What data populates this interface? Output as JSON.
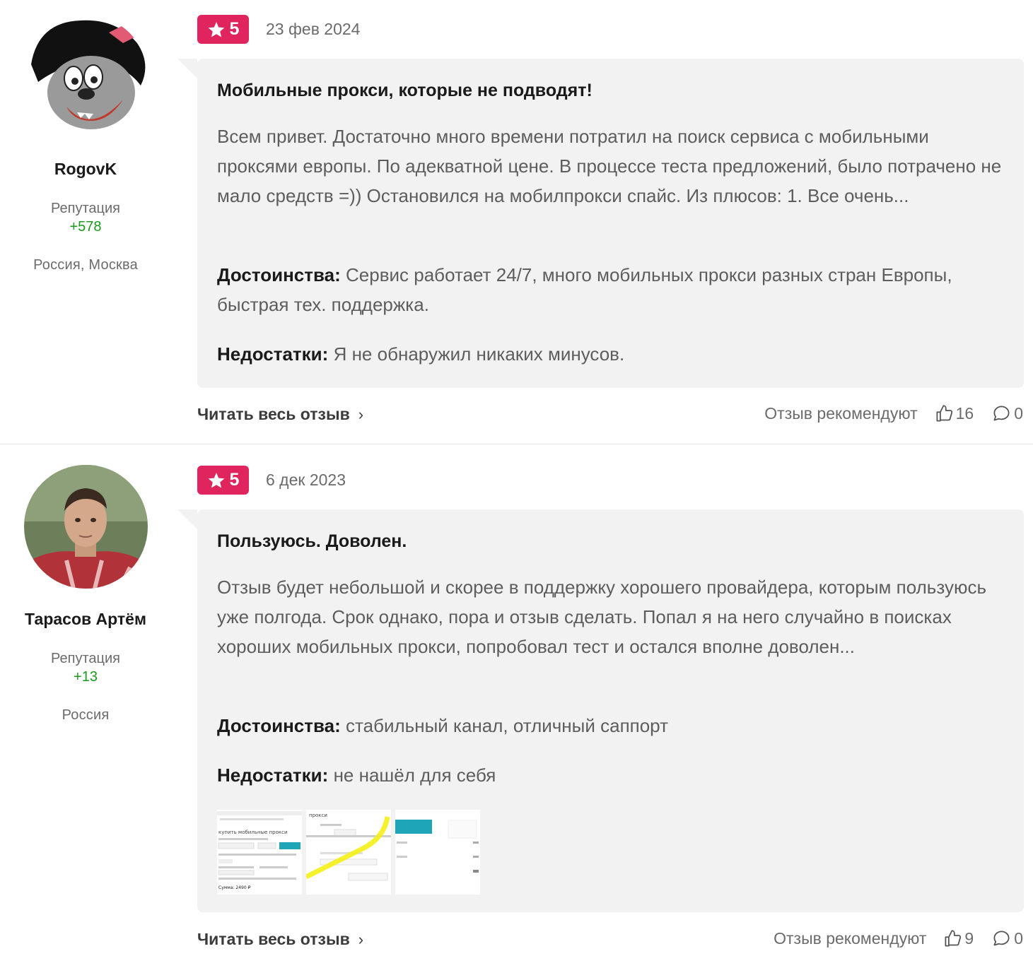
{
  "reviews": [
    {
      "author": {
        "name": "RogovK",
        "reputation_label": "Репутация",
        "reputation_value": "+578",
        "location": "Россия, Москва"
      },
      "rating": "5",
      "date": "23 фев 2024",
      "title": "Мобильные прокси, которые не подводят!",
      "text": "Всем привет. Достаточно много времени потратил на поиск сервиса с мобильными проксями европы. По адекватной цене. В процессе теста предложений, было потрачено не мало средств =)) Остановился на мобилпрокси спайс. Из плюсов: 1. Все очень...",
      "pros_label": "Достоинства:",
      "pros": "Сервис работает 24/7, много мобильных прокси разных стран Европы, быстрая тех. поддержка.",
      "cons_label": "Недостатки:",
      "cons": "Я не обнаружил никаких минусов.",
      "read_all": "Читать весь отзыв",
      "recommend_label": "Отзыв рекомендуют",
      "likes": "16",
      "comments": "0"
    },
    {
      "author": {
        "name": "Тарасов Артём",
        "reputation_label": "Репутация",
        "reputation_value": "+13",
        "location": "Россия"
      },
      "rating": "5",
      "date": "6 дек 2023",
      "title": "Пользуюсь. Доволен.",
      "text": "Отзыв будет небольшой и скорее в поддержку хорошего провайдера, которым пользуюсь уже полгода. Срок однако, пора и отзыв сделать. Попал я на него случайно в поисках хороших мобильных прокси, попробовал тест и остался вполне доволен...",
      "pros_label": "Достоинства:",
      "pros": "стабильный канал, отличный саппорт",
      "cons_label": "Недостатки:",
      "cons": "не нашёл для себя",
      "thumbnails": [
        {
          "caption": "купить мобильные прокси",
          "sum": "Сумма: 2490 ₽"
        },
        {
          "caption": "прокси"
        },
        {
          "caption": ""
        }
      ],
      "read_all": "Читать весь отзыв",
      "recommend_label": "Отзыв рекомендуют",
      "likes": "9",
      "comments": "0"
    }
  ],
  "colors": {
    "badge": "#e0245e",
    "card_bg": "#f2f2f2",
    "reputation": "#1b9a1b"
  }
}
